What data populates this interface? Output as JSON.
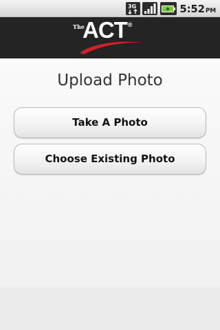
{
  "status_bar": {
    "network_label": "3G",
    "network_icon": "3g-data-icon",
    "signal_icon": "signal-strength-icon",
    "battery_icon": "battery-charging-icon",
    "time": "5:52",
    "ampm": "PM"
  },
  "header": {
    "logo_small_text": "The",
    "logo_text": "ACT",
    "logo_trademark": "®",
    "background_color": "#242424",
    "swoosh_color": "#d42027"
  },
  "main": {
    "title": "Upload Photo",
    "buttons": {
      "take_photo": "Take A Photo",
      "choose_existing": "Choose Existing Photo"
    }
  }
}
